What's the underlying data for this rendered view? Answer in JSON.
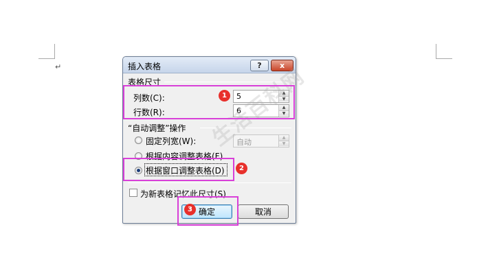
{
  "dialog": {
    "title": "插入表格",
    "help_label": "?",
    "close_label": "x"
  },
  "table_size": {
    "section_label": "表格尺寸",
    "columns_label": "列数(C):",
    "columns_value": "5",
    "rows_label": "行数(R):",
    "rows_value": "6"
  },
  "autofit": {
    "section_label": "“自动调整”操作",
    "fixed_width_label": "固定列宽(W):",
    "fixed_width_value": "自动",
    "fit_content_label": "根据内容调整表格(F)",
    "fit_window_label": "根据窗口调整表格(D)",
    "selected": "fit_window"
  },
  "remember": {
    "label": "为新表格记忆此尺寸(S)",
    "checked": false
  },
  "buttons": {
    "ok_label": "确定",
    "cancel_label": "取消"
  },
  "annotations": {
    "badge1": "1",
    "badge2": "2",
    "badge3": "3",
    "highlight_color": "#d83fd8",
    "badge_color": "#e8302c"
  },
  "document": {
    "paragraph_mark": "↵"
  },
  "watermark": {
    "text": "生活百科网"
  }
}
